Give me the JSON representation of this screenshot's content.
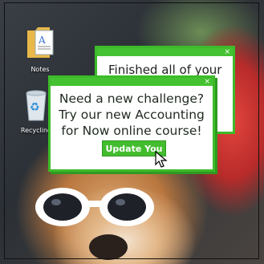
{
  "desktop": {
    "icons": [
      {
        "label": "Notes",
        "icon": "notes-file-icon"
      },
      {
        "label": "Recycling",
        "icon": "recycle-bin-icon"
      }
    ]
  },
  "popup_back": {
    "text": "Finished all of your",
    "close_symbol": "×"
  },
  "popup_front": {
    "message": "Need a new challenge? Try our new Accounting for Now online course!",
    "button_label": "Update You",
    "close_symbol": "×"
  },
  "colors": {
    "accent_green": "#45c232",
    "dark_green": "#2f9a22"
  }
}
